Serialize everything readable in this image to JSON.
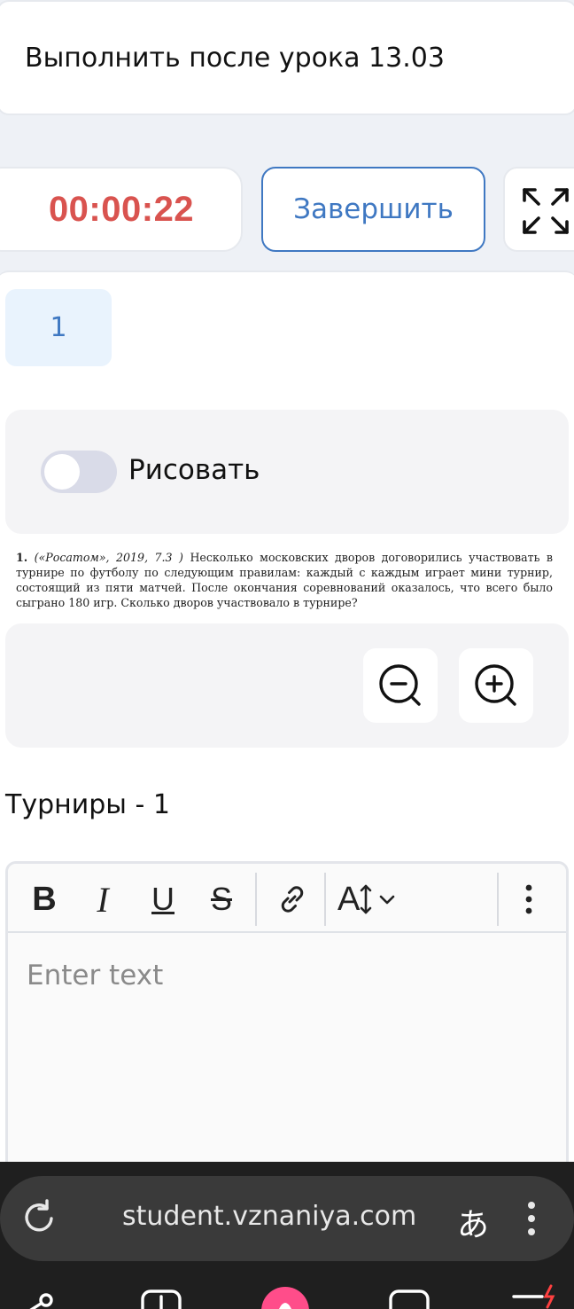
{
  "header": {
    "title": "Выполнить после урока 13.03"
  },
  "timer": {
    "value": "00:00:22"
  },
  "actions": {
    "finish_label": "Завершить"
  },
  "tabs": [
    {
      "label": "1"
    }
  ],
  "draw": {
    "label": "Рисовать",
    "enabled": false
  },
  "problem": {
    "number": "1.",
    "source": "(«Росатом», 2019, 7.3 )",
    "text": "Несколько московских дворов договорились участвовать в турнире по футболу по следующим правилам: каждый с каждым играет мини турнир, состоящий из пяти матчей. После окончания соревнований оказалось, что всего было сыграно 180 игр. Сколько дворов участвовало в турнире?"
  },
  "answer": {
    "title": "Турниры - 1",
    "placeholder": "Enter text"
  },
  "editor_toolbar": {
    "bold": "B",
    "italic": "I",
    "underline": "U",
    "strike": "S",
    "font_size": "A"
  },
  "browser": {
    "url": "student.vznaniya.com",
    "translate_glyph": "あ"
  },
  "colors": {
    "accent": "#3f78c2",
    "timer": "#d9534f",
    "tab_bg": "#e9f3fd"
  }
}
